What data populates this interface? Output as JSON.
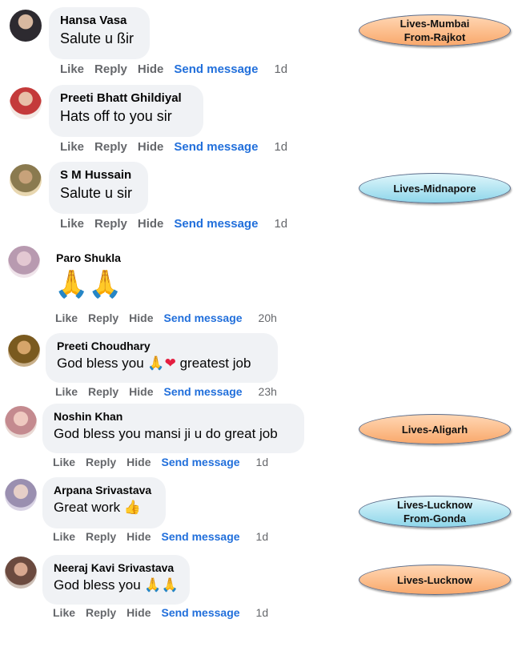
{
  "comments": [
    {
      "name": "Hansa Vasa",
      "text": "Salute u ßir",
      "time": "1d",
      "avatar_color": "#4a4650"
    },
    {
      "name": "Preeti Bhatt Ghildiyal",
      "text": "Hats off to you sir",
      "time": "1d",
      "avatar_color": "#c43a3a"
    },
    {
      "name": "S M Hussain",
      "text": "Salute u sir",
      "time": "1d",
      "avatar_color": "#8a7a4f"
    },
    {
      "name": "Paro Shukla",
      "text": "🙏🙏",
      "time": "20h",
      "avatar_color": "#b89ab0"
    },
    {
      "name": "Preeti Choudhary",
      "text": "God bless you",
      "text_suffix": "greatest job",
      "emoji_pray": "🙏",
      "emoji_heart": "❤",
      "time": "23h",
      "avatar_color": "#7a5a1f"
    },
    {
      "name": "Noshin Khan",
      "text": "God bless you mansi ji u do great job",
      "time": "1d",
      "avatar_color": "#c48a8f"
    },
    {
      "name": "Arpana Srivastava",
      "text": "Great work",
      "emoji": "👍",
      "time": "1d",
      "avatar_color": "#9a8fb0"
    },
    {
      "name": "Neeraj Kavi Srivastava",
      "text": "God bless you",
      "emoji": "🙏🙏",
      "time": "1d",
      "avatar_color": "#6b4a3f"
    }
  ],
  "actions": {
    "like": "Like",
    "reply": "Reply",
    "hide": "Hide",
    "send": "Send message"
  },
  "tags": [
    {
      "line1": "Lives-Mumbai",
      "line2": "From-Rajkot",
      "style": "orange"
    },
    {
      "line1": "Lives-Midnapore",
      "line2": "",
      "style": "blue"
    },
    {
      "line1": "Lives-Aligarh",
      "line2": "",
      "style": "orange"
    },
    {
      "line1": "Lives-Lucknow",
      "line2": "From-Gonda",
      "style": "blue"
    },
    {
      "line1": "Lives-Lucknow",
      "line2": "",
      "style": "orange"
    }
  ],
  "colors": {
    "bubble": "#f0f2f5",
    "action": "#65676b",
    "link": "#216fdb",
    "heart": "#e41e3f"
  }
}
